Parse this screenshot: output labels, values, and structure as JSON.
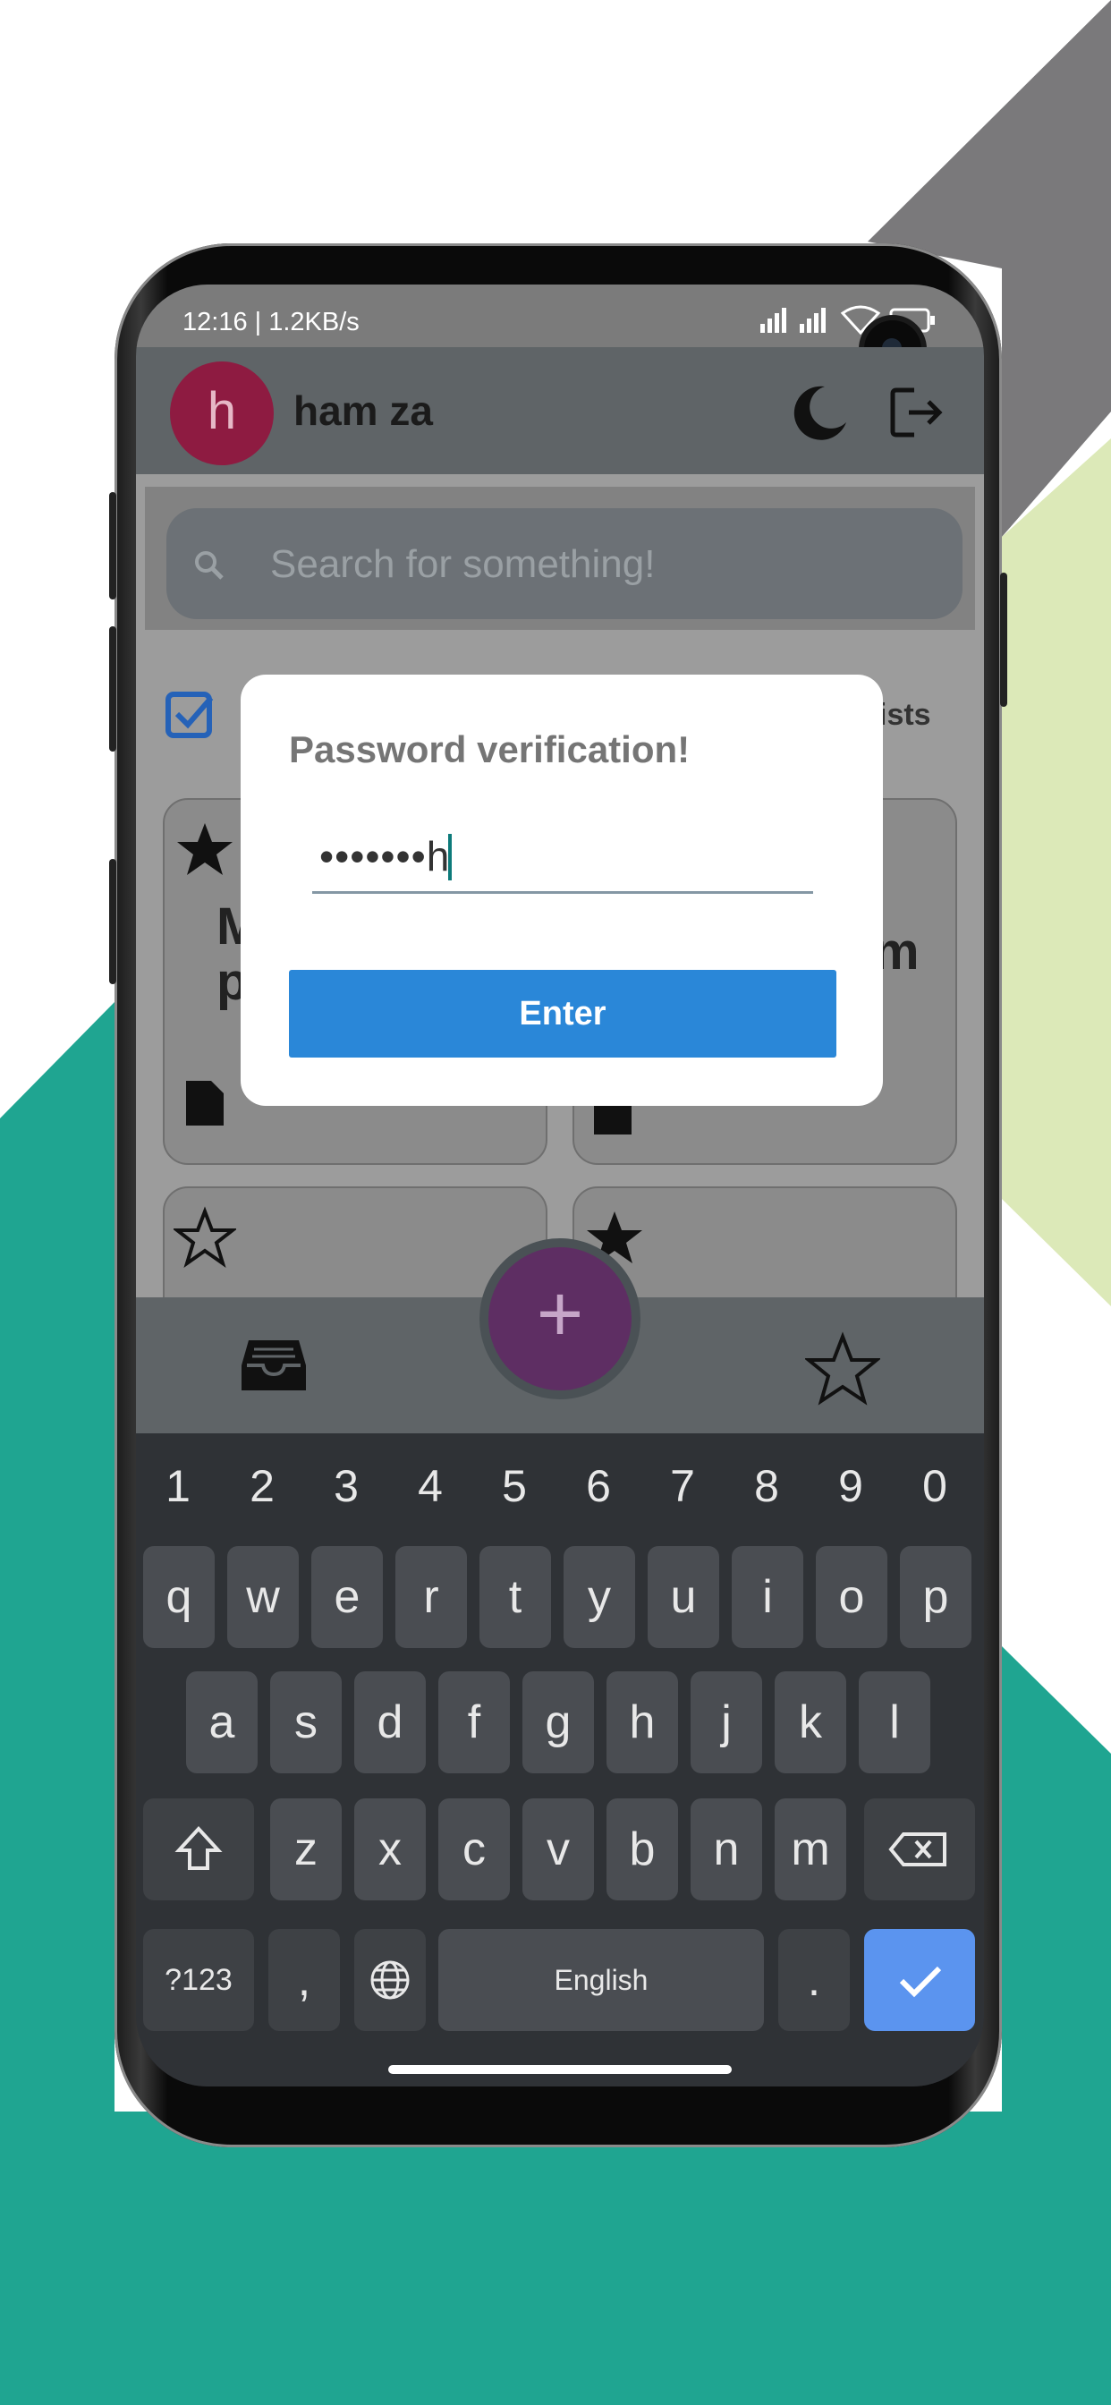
{
  "colors": {
    "accent_teal": "#1fa591",
    "accent_grey": "#7a797b",
    "accent_lime": "#dce9b8",
    "avatar_bg": "#8e1b41",
    "enter_button": "#2a87d8",
    "fab_bg": "#5e2e63",
    "confirm_key": "#5b94ef"
  },
  "status_bar": {
    "time_speed": "12:16 | 1.2KB/s",
    "icons": [
      "signal-icon",
      "signal-icon",
      "wifi-icon",
      "battery-icon"
    ]
  },
  "header": {
    "avatar_letter": "h",
    "username": "ham za",
    "icons": [
      "moon-icon",
      "logout-icon"
    ]
  },
  "search": {
    "placeholder": "Search for something!"
  },
  "filters": {
    "lists_label": "ists"
  },
  "cards": {
    "card1_title_line1": "M",
    "card1_title_line2": "p",
    "card2_title_line1": "m"
  },
  "bottom_nav": {
    "fab_label": "+",
    "icons": [
      "inbox-icon",
      "star-icon"
    ]
  },
  "dialog": {
    "title": "Password verification!",
    "password_value": "•••••••h",
    "enter_label": "Enter"
  },
  "keyboard": {
    "number_row": [
      "1",
      "2",
      "3",
      "4",
      "5",
      "6",
      "7",
      "8",
      "9",
      "0"
    ],
    "row1": [
      "q",
      "w",
      "e",
      "r",
      "t",
      "y",
      "u",
      "i",
      "o",
      "p"
    ],
    "row2": [
      "a",
      "s",
      "d",
      "f",
      "g",
      "h",
      "j",
      "k",
      "l"
    ],
    "row3": [
      "z",
      "x",
      "c",
      "v",
      "b",
      "n",
      "m"
    ],
    "symbols_label": "?123",
    "comma_label": ",",
    "space_label": "English",
    "period_label": "."
  }
}
